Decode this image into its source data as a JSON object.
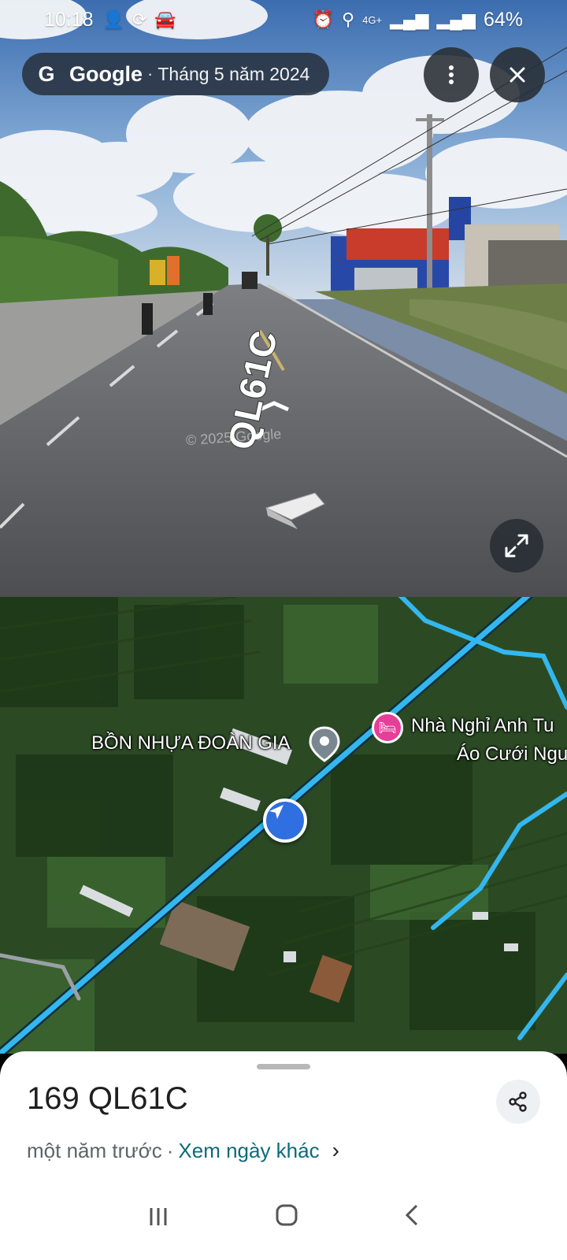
{
  "status_bar": {
    "time": "10:18",
    "left_icons": [
      "person-add-icon",
      "sync-icon",
      "car-icon"
    ],
    "right_icons": [
      "alarm-icon",
      "location-icon",
      "4g-icon",
      "signal-icon",
      "signal-icon"
    ],
    "network": "4G+",
    "battery": "64%"
  },
  "header": {
    "brand": "Google",
    "separator": "·",
    "capture_date": "Tháng 5 năm 2024"
  },
  "street_view": {
    "road_label": "QL61C",
    "watermark": "© 2025 Google"
  },
  "map": {
    "labels": {
      "poi_1": "BỒN NHỰA ĐOÀN GIA",
      "poi_2_line1": "Nhà Nghỉ Anh Tu",
      "poi_2_line2": "Áo Cưới Ngu"
    }
  },
  "sheet": {
    "title": "169 QL61C",
    "ago": "một năm trước",
    "separator": "·",
    "other_dates_link": "Xem ngày khác"
  },
  "colors": {
    "road_highlight": "#33b7ee",
    "nav_marker": "#2f6fe0",
    "poi_pink": "#e73e97",
    "link": "#0b6b7a"
  }
}
